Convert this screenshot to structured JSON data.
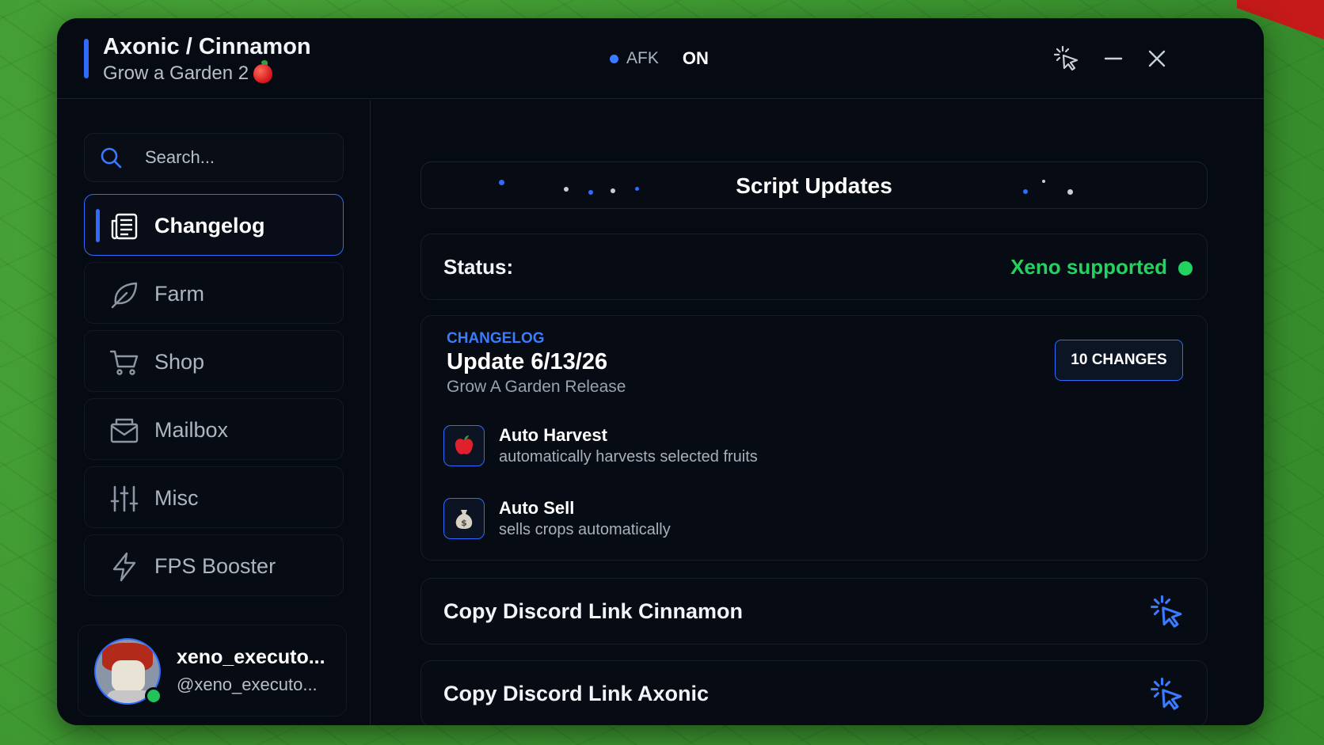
{
  "window": {
    "title": "Axonic / Cinnamon",
    "subtitle": "Grow a Garden 2",
    "afk_label": "AFK",
    "afk_value": "ON",
    "accent_color": "#2f6bff"
  },
  "sidebar": {
    "search_placeholder": "Search...",
    "items": [
      {
        "label": "Changelog",
        "icon": "changelog-icon",
        "active": true
      },
      {
        "label": "Farm",
        "icon": "leaf-icon",
        "active": false
      },
      {
        "label": "Shop",
        "icon": "cart-icon",
        "active": false
      },
      {
        "label": "Mailbox",
        "icon": "mail-icon",
        "active": false
      },
      {
        "label": "Misc",
        "icon": "sliders-icon",
        "active": false
      },
      {
        "label": "FPS Booster",
        "icon": "lightning-icon",
        "active": false
      }
    ],
    "profile": {
      "name": "xeno_executo...",
      "handle": "@xeno_executo..."
    }
  },
  "main": {
    "header_title": "Script Updates",
    "status": {
      "label": "Status:",
      "value": "Xeno supported",
      "color": "#22d35f"
    },
    "changelog": {
      "eyebrow": "CHANGELOG",
      "title": "Update 6/13/26",
      "subtitle": "Grow A Garden Release",
      "badge": "10 CHANGES",
      "features": [
        {
          "title": "Auto Harvest",
          "description": "automatically harvests selected fruits",
          "icon": "apple-icon"
        },
        {
          "title": "Auto Sell",
          "description": "sells crops automatically",
          "icon": "money-bag-icon"
        }
      ]
    },
    "actions": [
      {
        "label": "Copy Discord Link Cinnamon",
        "icon": "click-icon"
      },
      {
        "label": "Copy Discord Link Axonic",
        "icon": "click-icon"
      }
    ]
  }
}
